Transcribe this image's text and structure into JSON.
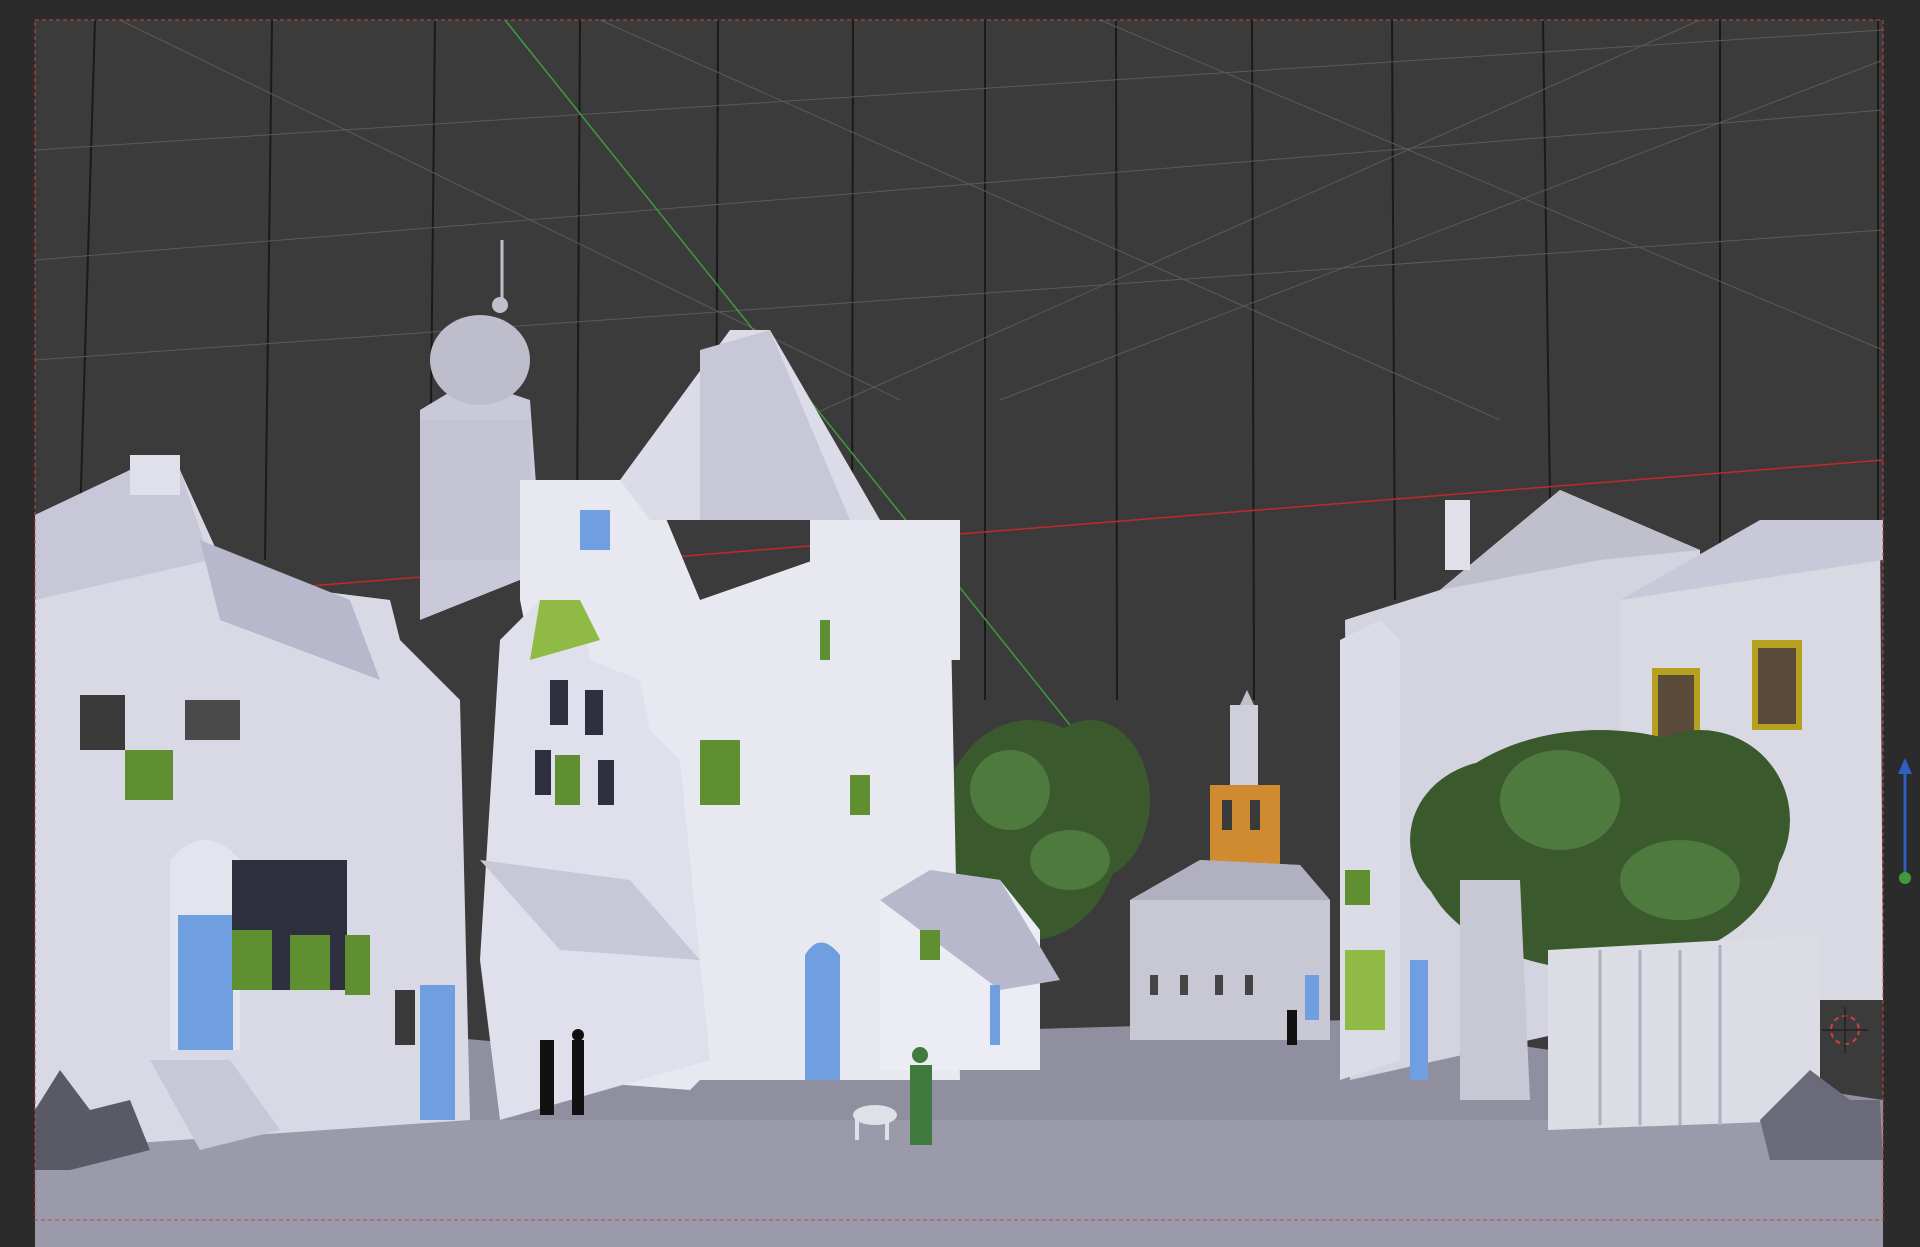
{
  "viewport": {
    "mode": "camera-view",
    "shading": "solid",
    "colors": {
      "background": "#3d3d3d",
      "outside_camera": "#2b2b2b",
      "camera_frame": "#d04040",
      "x_axis": "#c02a2a",
      "y_axis": "#3f9a3f",
      "z_axis": "#2f5fc0",
      "grid": "#5a5a5a",
      "building": "#d9d9e6",
      "building_shade": "#b8b8cc",
      "ground": "#8f8fa0",
      "window_blue": "#6f9fe0",
      "shutter_green": "#5f8f30",
      "foliage": "#3a5a2e",
      "tower_orange": "#d08a30"
    }
  },
  "gizmos": {
    "navigation_icon": "z-axis-arrow-icon",
    "cursor_icon": "3d-cursor-icon"
  }
}
